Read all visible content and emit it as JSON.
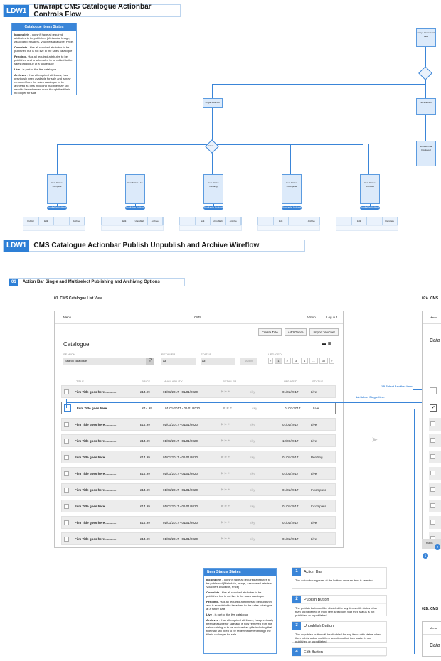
{
  "top": {
    "tag": "LDW1",
    "title": "Unwrapt CMS Catalogue Actionbar Controls Flow"
  },
  "legend": {
    "title": "Catalogue Items States",
    "items": [
      {
        "term": "Incomplete",
        "text": "- doesn't have all required attributes to be published (Metadata, Image, Associated retailers, Vouchers available, Price)"
      },
      {
        "term": "Complete",
        "text": "- Has all required attributes to be published but is not live in the sales catalogue"
      },
      {
        "term": "Pending",
        "text": "- Has all required attributes to be published and is scheduled to be added to the sales catalogue at a future date"
      },
      {
        "term": "Live",
        "text": "- is part of the live catalogue"
      },
      {
        "term": "Archived",
        "text": "- Has all required attributes, has previously been available for sale and is now removed from the sales catalogue to be archived as gifts including that title may still need to be redeemed even though the title is no longer for sale"
      }
    ]
  },
  "flow": {
    "entry": "Entry - Default List View",
    "single": "Single Selection",
    "noSel": "No Selection",
    "noBar": "No Action Bar Displayed",
    "select": "Select",
    "states": [
      {
        "label": "Item Status Complete",
        "pill": "Available Actions",
        "actions": [
          "Publish",
          "Edit",
          "",
          "Archive"
        ]
      },
      {
        "label": "Item Status Live",
        "pill": "Available Actions",
        "actions": [
          "",
          "Edit",
          "Unpublish",
          "Archive"
        ]
      },
      {
        "label": "Item Status Pending",
        "pill": "Available Actions",
        "actions": [
          "",
          "Edit",
          "Unpublish",
          "Archive"
        ]
      },
      {
        "label": "Item Status Incomplete",
        "pill": "Available Actions",
        "actions": [
          "",
          "Edit",
          "",
          "Archive"
        ]
      },
      {
        "label": "Item Status Archived",
        "pill": "Available Actions",
        "actions": [
          "",
          "Edit",
          "",
          "Reinstate"
        ]
      }
    ]
  },
  "section2": {
    "tag": "LDW1",
    "title": "CMS Catalogue Actionbar Publish Unpublish and Archive Wireflow"
  },
  "sub": {
    "num": "01",
    "title": "Action Bar Single and Multiselect Publishing and Archiving Options"
  },
  "wf1": {
    "label": "01. CMS Catalogue List View",
    "menu": "Menu",
    "center": "CMS",
    "admin": "Admin",
    "logout": "Log out",
    "buttons": [
      "Create Title",
      "Add Genre",
      "Import Voucher"
    ],
    "heading": "Catalogue",
    "searchLbl": "SEARCH",
    "searchPh": "Search catalogue",
    "retailerLbl": "RETAILER",
    "retailerVal": "All",
    "statusLbl": "STATUS",
    "statusVal": "All",
    "apply": "Apply",
    "updatedLbl": "UPDATED",
    "pages": [
      "1",
      "2",
      "3",
      "4",
      "...",
      "30"
    ],
    "cols": [
      "TITLE",
      "PRICE",
      "AVAILABILITY",
      "RETAILER",
      "UPDATED",
      "STATUS"
    ],
    "rows": [
      {
        "title": "Film Title goes here.............",
        "price": "£14.99",
        "avail": "01/01/2017 - 01/01/2020",
        "upd": "01/01/2017",
        "status": "Live"
      },
      {
        "title": "Film Title goes here.............",
        "price": "£14.99",
        "avail": "01/01/2017 - 01/01/2020",
        "upd": "01/01/2017",
        "status": "Live"
      },
      {
        "title": "Film Title goes here.............",
        "price": "£14.99",
        "avail": "01/01/2017 - 01/01/2020",
        "upd": "01/01/2017",
        "status": "Live"
      },
      {
        "title": "Film Title goes here.............",
        "price": "£14.99",
        "avail": "01/01/2017 - 01/01/2020",
        "upd": "12/09/2017",
        "status": "Live"
      },
      {
        "title": "Film Title goes here.............",
        "price": "£14.99",
        "avail": "01/01/2017 - 01/01/2020",
        "upd": "01/01/2017",
        "status": "Pending"
      },
      {
        "title": "Film Title goes here.............",
        "price": "£14.99",
        "avail": "01/01/2017 - 01/01/2020",
        "upd": "01/01/2017",
        "status": "Live"
      },
      {
        "title": "Film Title goes here.............",
        "price": "£14.99",
        "avail": "01/01/2017 - 01/01/2020",
        "upd": "01/01/2017",
        "status": "Incomplete"
      },
      {
        "title": "Film Title goes here.............",
        "price": "£14.99",
        "avail": "01/01/2017 - 01/01/2020",
        "upd": "01/01/2017",
        "status": "Incomplete"
      },
      {
        "title": "Film Title goes here.............",
        "price": "£14.99",
        "avail": "01/01/2017 - 01/01/2020",
        "upd": "01/01/2017",
        "status": "Live"
      },
      {
        "title": "Film Title goes here.............",
        "price": "£14.99",
        "avail": "01/01/2017 - 01/01/2020",
        "upd": "01/01/2017",
        "status": "Live"
      }
    ],
    "sky": "sky"
  },
  "annot": {
    "a": "1A.Select Single Item",
    "b": "1B.Select Another Item"
  },
  "wf2a": {
    "label": "02A. CMS",
    "menu": "Menu",
    "heading": "Cata",
    "publish": "Publis"
  },
  "wf2b": {
    "label": "02B. CMS",
    "menu": "Menu",
    "heading": "Cata"
  },
  "itemStates": {
    "title": "Item Status States",
    "items": [
      {
        "term": "Incomplete",
        "text": "- doesn't have all required attributes to be published (Metadata, Image, Associated retailers, Vouchers available, Price)"
      },
      {
        "term": "Complete",
        "text": "- Has all required attributes to be published but is not live in the sales catalogue"
      },
      {
        "term": "Pending",
        "text": "- Has all required attributes to be published and is scheduled to be added to the sales catalogue at a future date"
      },
      {
        "term": "Live",
        "text": "- is part of the live catalogue"
      },
      {
        "term": "Archived",
        "text": "- Has all required attributes, has previously been available for sale and is now removed from the sales catalogue to be archived as gifts including that title may still need to be redeemed even though the title is no longer for sale"
      }
    ]
  },
  "notes": [
    {
      "n": "1",
      "title": "Action Bar",
      "text": "The action bar appears at the bottom once an item is selected"
    },
    {
      "n": "2",
      "title": "Publish Button",
      "text": "The publish button will be disabled for any items with status other than unpublished or multi item selections that their status is not published or unpublished"
    },
    {
      "n": "3",
      "title": "Unpublish Button",
      "text": "The unpublish button will be disabled for any items with status other than published or multi item selections that their status is not published or unpublished"
    },
    {
      "n": "4",
      "title": "Edit Button",
      "text": ""
    }
  ],
  "badges": [
    "1",
    "2"
  ],
  "colors": {
    "accent": "#3a85d8",
    "light": "#dceafa"
  }
}
